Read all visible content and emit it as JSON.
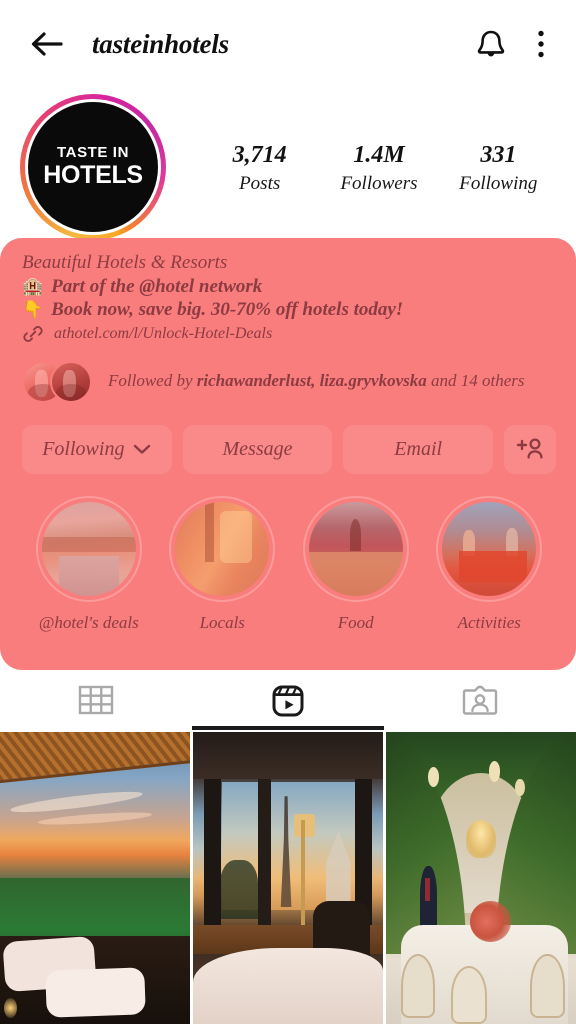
{
  "header": {
    "username": "tasteinhotels",
    "back_icon": "arrow-left-icon",
    "bell_icon": "bell-icon",
    "menu_icon": "more-vertical-icon"
  },
  "profile": {
    "avatar": {
      "line1": "TASTE IN",
      "line2": "HOTELS",
      "has_story_ring": true,
      "ring_colors": [
        "#f9a826",
        "#ef7d3e",
        "#e8436f",
        "#d6249f",
        "#c32aa3"
      ],
      "background": "#0a0a0a"
    },
    "stats": [
      {
        "value": "3,714",
        "label": "Posts"
      },
      {
        "value": "1.4M",
        "label": "Followers"
      },
      {
        "value": "331",
        "label": "Following"
      }
    ]
  },
  "bio": {
    "title": "Beautiful Hotels & Resorts",
    "lines": [
      {
        "emoji": "🏨",
        "emoji_name": "hotel-emoji",
        "text": "Part of the @hotel network"
      },
      {
        "emoji": "👇",
        "emoji_name": "point-down-emoji",
        "text": "Book now, save big. 30-70% off hotels today!"
      }
    ],
    "link": {
      "icon": "link-icon",
      "text": "athotel.com/l/Unlock-Hotel-Deals"
    }
  },
  "followed_by": {
    "prefix": "Followed by",
    "names": "richawanderlust, liza.gryvkovska",
    "suffix": "and 14 others",
    "avatar_count": 2
  },
  "actions": [
    {
      "label": "Following",
      "icon": "chevron-down-icon",
      "name": "following-button"
    },
    {
      "label": "Message",
      "icon": "",
      "name": "message-button"
    },
    {
      "label": "Email",
      "icon": "",
      "name": "email-button"
    },
    {
      "label": "",
      "icon": "add-person-icon",
      "name": "add-person-button"
    }
  ],
  "highlights": [
    {
      "label": "@hotel's deals",
      "art": "h1"
    },
    {
      "label": "Locals",
      "art": "h2"
    },
    {
      "label": "Food",
      "art": "h3"
    },
    {
      "label": "Activities",
      "art": "h4"
    }
  ],
  "tabs": [
    {
      "name": "tab-grid",
      "icon": "grid-icon",
      "active": false
    },
    {
      "name": "tab-reels",
      "icon": "reels-icon",
      "active": true
    },
    {
      "name": "tab-tagged",
      "icon": "tagged-person-icon",
      "active": false
    }
  ],
  "grid_posts": [
    {
      "name": "post-rice-field-sunset-bed",
      "art": "c1"
    },
    {
      "name": "post-paris-eiffel-hotel-room",
      "art": "c2"
    },
    {
      "name": "post-greenery-arch-banquet-hall",
      "art": "c3"
    }
  ],
  "colors": {
    "overlay_pink": "#fa7d7d",
    "button_pink": "#fa8a8a",
    "overlay_text": "#8c3b42",
    "primary_text": "#121212",
    "tab_active": "#1a1a1a",
    "tab_inactive": "#a8a8a8"
  }
}
